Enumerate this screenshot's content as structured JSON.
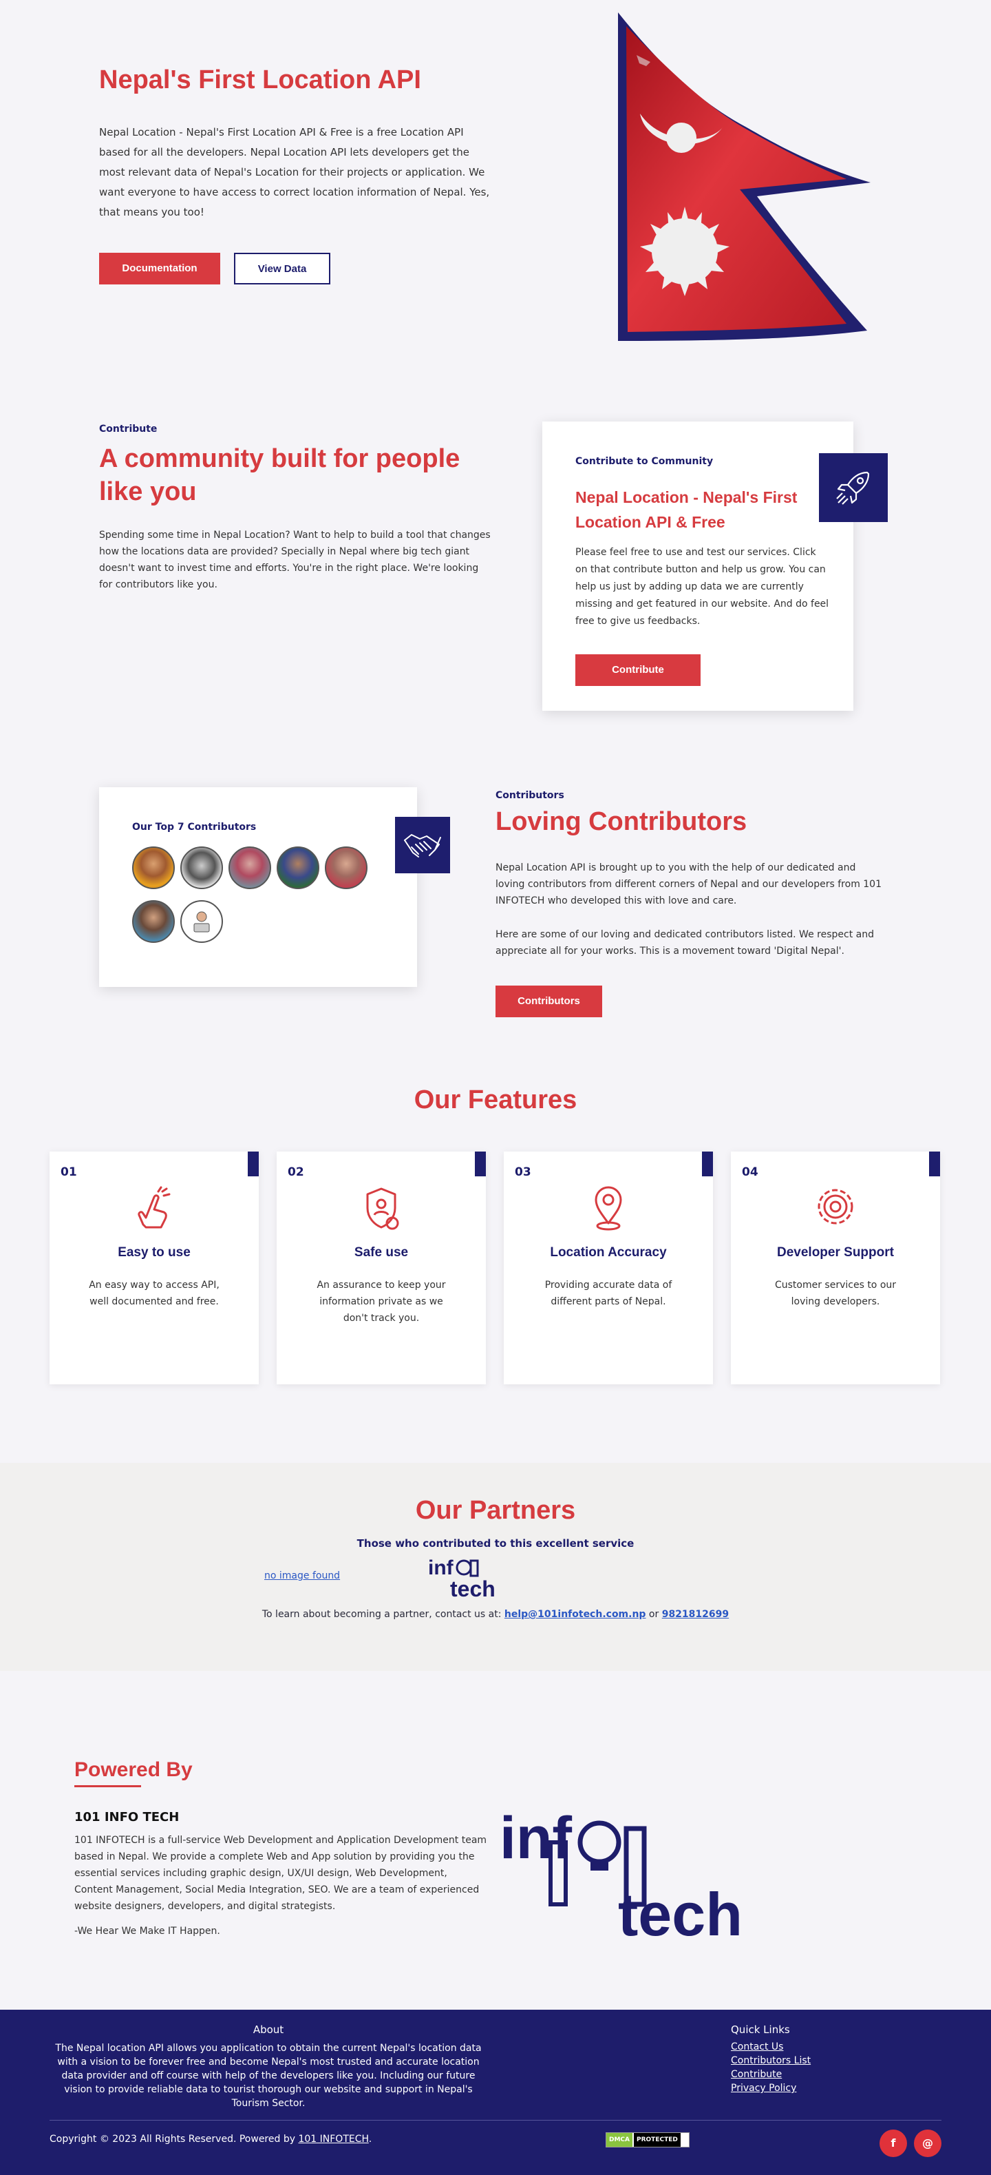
{
  "colors": {
    "brand_red": "#d63b3f",
    "brand_navy": "#1c1c6b",
    "footer_bg": "#1e1d6b",
    "partners_bg": "#f1f0ef"
  },
  "hero": {
    "title": "Nepal's First Location API",
    "text": "Nepal Location - Nepal's First Location API & Free is a free Location API based for all the developers. Nepal Location API lets developers get the most relevant data of Nepal's Location for their projects or application. We want everyone to have access to correct location information of Nepal. Yes, that means you too!",
    "documentation_label": "Documentation",
    "view_data_label": "View Data"
  },
  "contribute": {
    "eyebrow": "Contribute",
    "title": "A community built for people like you",
    "text": "Spending some time in Nepal Location? Want to help to build a tool that changes how the locations data are provided? Specially in Nepal where big tech giant doesn't want to invest time and efforts. You're in the right place. We're looking for contributors like you.",
    "card": {
      "eyebrow": "Contribute to Community",
      "title": "Nepal Location - Nepal's First Location API & Free",
      "text": "Please feel free to use and test our services. Click on that contribute button and help us grow. You can help us just by adding up data we are currently missing and get featured in our website. And do feel free to give us feedbacks.",
      "button": "Contribute",
      "icon": "rocket-icon"
    }
  },
  "contributors": {
    "card_title": "Our Top 7 Contributors",
    "icon": "handshake-icon",
    "eyebrow": "Contributors",
    "title": "Loving Contributors",
    "text1": "Nepal Location API is brought up to you with the help of our dedicated and loving contributors from different corners of Nepal and our developers from 101 INFOTECH who developed this with love and care.",
    "text2": "Here are some of our loving and dedicated contributors listed. We respect and appreciate all for your works. This is a movement toward 'Digital Nepal'.",
    "button": "Contributors"
  },
  "features": {
    "title": "Our Features",
    "items": [
      {
        "num": "01",
        "title": "Easy to use",
        "text": "An easy way to access API, well documented and free.",
        "icon": "hand-tap-icon"
      },
      {
        "num": "02",
        "title": "Safe use",
        "text": "An assurance to keep your information private as we don't track you.",
        "icon": "shield-user-icon"
      },
      {
        "num": "03",
        "title": "Location Accuracy",
        "text": "Providing accurate data of different parts of Nepal.",
        "icon": "location-pin-icon"
      },
      {
        "num": "04",
        "title": "Developer Support",
        "text": "Customer services to our loving developers.",
        "icon": "gear-support-icon"
      }
    ]
  },
  "partners": {
    "title": "Our Partners",
    "subtitle": "Those who contributed to this excellent service",
    "broken_image": "no image found",
    "logo_text": "infotech",
    "contact_prefix": "To learn about becoming a partner, contact us at:",
    "email": "help@101infotech.com.np",
    "or": "or",
    "phone": "9821812699"
  },
  "powered_by": {
    "title": "Powered By",
    "company": "101 INFO TECH",
    "text": "101 INFOTECH is a full-service Web Development and Application Development team based in Nepal. We provide a complete Web and App solution by providing you the essential services including graphic design, UX/UI design, Web Development, Content Management, Social Media Integration, SEO. We are a team of experienced website designers, developers, and digital strategists.",
    "slogan": "-We Hear We Make IT Happen."
  },
  "footer": {
    "about_title": "About",
    "about_text": "The Nepal location API allows you application to obtain the current Nepal's location data with a vision to be forever free and become Nepal's most trusted and accurate location data provider and off course with help of the developers like you. Including our future vision to provide reliable data to tourist thorough our website and support in Nepal's Tourism Sector.",
    "quick_links_title": "Quick Links",
    "links": [
      "Contact Us",
      "Contributors List",
      "Contribute",
      "Privacy Policy"
    ],
    "copyright": "Copyright © 2023 All Rights Reserved. Powered by",
    "copyright_link": "101 INFOTECH",
    "dmca_left": "DMCA",
    "dmca_right": "PROTECTED",
    "social": [
      {
        "icon": "facebook-icon",
        "glyph": "f"
      },
      {
        "icon": "email-icon",
        "glyph": "@"
      }
    ]
  }
}
